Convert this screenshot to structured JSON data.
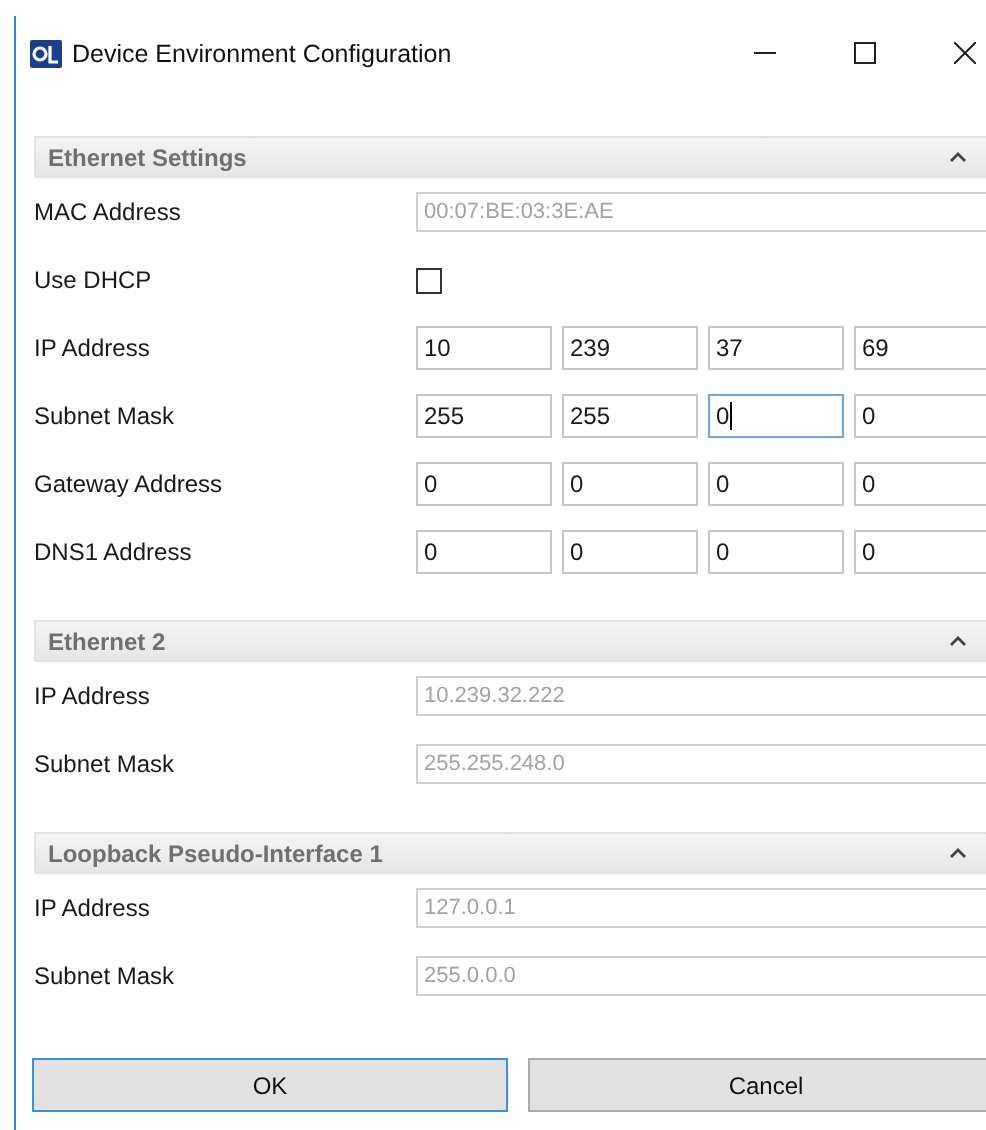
{
  "window": {
    "title": "Device Environment Configuration"
  },
  "sections": [
    {
      "title": "Ethernet Settings",
      "expanded": true,
      "rows": [
        {
          "kind": "text",
          "label": "MAC Address",
          "value": "00:07:BE:03:3E:AE",
          "disabled": true
        },
        {
          "kind": "checkbox",
          "label": "Use DHCP",
          "checked": false
        },
        {
          "kind": "ip",
          "label": "IP Address",
          "octets": [
            {
              "value": "10",
              "focused": false
            },
            {
              "value": "239",
              "focused": false
            },
            {
              "value": "37",
              "focused": false
            },
            {
              "value": "69",
              "focused": false
            }
          ]
        },
        {
          "kind": "ip",
          "label": "Subnet Mask",
          "octets": [
            {
              "value": "255",
              "focused": false
            },
            {
              "value": "255",
              "focused": false
            },
            {
              "value": "0",
              "focused": true
            },
            {
              "value": "0",
              "focused": false
            }
          ]
        },
        {
          "kind": "ip",
          "label": "Gateway Address",
          "octets": [
            {
              "value": "0",
              "focused": false
            },
            {
              "value": "0",
              "focused": false
            },
            {
              "value": "0",
              "focused": false
            },
            {
              "value": "0",
              "focused": false
            }
          ]
        },
        {
          "kind": "ip",
          "label": "DNS1 Address",
          "octets": [
            {
              "value": "0",
              "focused": false
            },
            {
              "value": "0",
              "focused": false
            },
            {
              "value": "0",
              "focused": false
            },
            {
              "value": "0",
              "focused": false
            }
          ]
        }
      ]
    },
    {
      "title": "Ethernet 2",
      "expanded": true,
      "rows": [
        {
          "kind": "text",
          "label": "IP Address",
          "value": "10.239.32.222",
          "disabled": true
        },
        {
          "kind": "text",
          "label": "Subnet Mask",
          "value": "255.255.248.0",
          "disabled": true
        }
      ]
    },
    {
      "title": "Loopback Pseudo-Interface 1",
      "expanded": true,
      "rows": [
        {
          "kind": "text",
          "label": "IP Address",
          "value": "127.0.0.1",
          "disabled": true
        },
        {
          "kind": "text",
          "label": "Subnet Mask",
          "value": "255.0.0.0",
          "disabled": true
        }
      ]
    }
  ],
  "buttons": [
    {
      "label": "OK",
      "default": true
    },
    {
      "label": "Cancel",
      "default": false
    }
  ]
}
